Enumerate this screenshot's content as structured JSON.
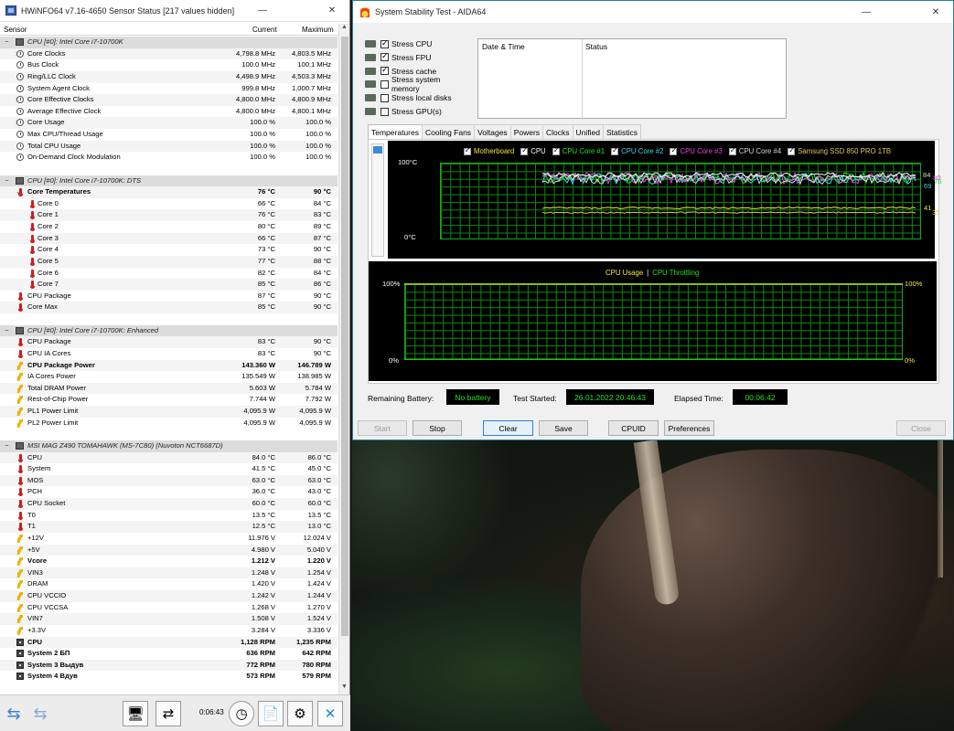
{
  "hwinfo": {
    "title": "HWiNFO64 v7.16-4650 Sensor Status [217 values hidden]",
    "columns": {
      "sensor": "Sensor",
      "current": "Current",
      "maximum": "Maximum"
    },
    "elapsed": "0:06:43",
    "rows": [
      {
        "type": "hdr",
        "label": "CPU [#0]: Intel Core i7-10700K",
        "expander": "−"
      },
      {
        "type": "data",
        "icon": "clock",
        "expander": "›",
        "label": "Core Clocks",
        "cur": "4,798.8 MHz",
        "max": "4,803.5 MHz",
        "alt": true
      },
      {
        "type": "data",
        "icon": "clock",
        "label": "Bus Clock",
        "cur": "100.0 MHz",
        "max": "100.1 MHz"
      },
      {
        "type": "data",
        "icon": "clock",
        "label": "Ring/LLC Clock",
        "cur": "4,498.9 MHz",
        "max": "4,503.3 MHz",
        "alt": true
      },
      {
        "type": "data",
        "icon": "clock",
        "label": "System Agent Clock",
        "cur": "999.8 MHz",
        "max": "1,000.7 MHz"
      },
      {
        "type": "data",
        "icon": "clock",
        "expander": "›",
        "label": "Core Effective Clocks",
        "cur": "4,800.0 MHz",
        "max": "4,800.9 MHz",
        "alt": true
      },
      {
        "type": "data",
        "icon": "clock",
        "label": "Average Effective Clock",
        "cur": "4,800.0 MHz",
        "max": "4,800.1 MHz"
      },
      {
        "type": "data",
        "icon": "clock",
        "expander": "›",
        "label": "Core Usage",
        "cur": "100.0 %",
        "max": "100.0 %",
        "alt": true
      },
      {
        "type": "data",
        "icon": "clock",
        "label": "Max CPU/Thread Usage",
        "cur": "100.0 %",
        "max": "100.0 %"
      },
      {
        "type": "data",
        "icon": "clock",
        "label": "Total CPU Usage",
        "cur": "100.0 %",
        "max": "100.0 %",
        "alt": true
      },
      {
        "type": "data",
        "icon": "clock",
        "label": "On-Demand Clock Modulation",
        "cur": "100.0 %",
        "max": "100.0 %"
      },
      {
        "type": "blank"
      },
      {
        "type": "hdr",
        "label": "CPU [#0]: Intel Core i7-10700K: DTS",
        "expander": "−"
      },
      {
        "type": "data",
        "icon": "therm",
        "expander": "⌄",
        "label": "Core Temperatures",
        "cur": "76 °C",
        "max": "90 °C",
        "bold": true,
        "alt": true
      },
      {
        "type": "sub",
        "icon": "therm",
        "label": "Core 0",
        "cur": "66 °C",
        "max": "84 °C"
      },
      {
        "type": "sub",
        "icon": "therm",
        "label": "Core 1",
        "cur": "76 °C",
        "max": "83 °C",
        "alt": true
      },
      {
        "type": "sub",
        "icon": "therm",
        "label": "Core 2",
        "cur": "80 °C",
        "max": "89 °C"
      },
      {
        "type": "sub",
        "icon": "therm",
        "label": "Core 3",
        "cur": "66 °C",
        "max": "87 °C",
        "alt": true
      },
      {
        "type": "sub",
        "icon": "therm",
        "label": "Core 4",
        "cur": "73 °C",
        "max": "90 °C"
      },
      {
        "type": "sub",
        "icon": "therm",
        "label": "Core 5",
        "cur": "77 °C",
        "max": "88 °C",
        "alt": true
      },
      {
        "type": "sub",
        "icon": "therm",
        "label": "Core 6",
        "cur": "82 °C",
        "max": "84 °C"
      },
      {
        "type": "sub",
        "icon": "therm",
        "label": "Core 7",
        "cur": "85 °C",
        "max": "86 °C",
        "alt": true
      },
      {
        "type": "data",
        "icon": "therm",
        "label": "CPU Package",
        "cur": "87 °C",
        "max": "90 °C"
      },
      {
        "type": "data",
        "icon": "therm",
        "label": "Core Max",
        "cur": "85 °C",
        "max": "90 °C",
        "alt": true
      },
      {
        "type": "blank"
      },
      {
        "type": "hdr",
        "label": "CPU [#0]: Intel Core i7-10700K: Enhanced",
        "expander": "−"
      },
      {
        "type": "data",
        "icon": "therm",
        "label": "CPU Package",
        "cur": "83 °C",
        "max": "90 °C",
        "alt": true
      },
      {
        "type": "data",
        "icon": "therm",
        "label": "CPU IA Cores",
        "cur": "83 °C",
        "max": "90 °C"
      },
      {
        "type": "data",
        "icon": "volt",
        "label": "CPU Package Power",
        "cur": "143.360 W",
        "max": "146.789 W",
        "bold": true,
        "alt": true
      },
      {
        "type": "data",
        "icon": "volt",
        "label": "IA Cores Power",
        "cur": "135.549 W",
        "max": "138.985 W"
      },
      {
        "type": "data",
        "icon": "volt",
        "label": "Total DRAM Power",
        "cur": "5.603 W",
        "max": "5.784 W",
        "alt": true
      },
      {
        "type": "data",
        "icon": "volt",
        "label": "Rest-of-Chip Power",
        "cur": "7.744 W",
        "max": "7.792 W"
      },
      {
        "type": "data",
        "icon": "volt",
        "label": "PL1 Power Limit",
        "cur": "4,095.9 W",
        "max": "4,095.9 W",
        "alt": true
      },
      {
        "type": "data",
        "icon": "volt",
        "label": "PL2 Power Limit",
        "cur": "4,095.9 W",
        "max": "4,095.9 W"
      },
      {
        "type": "blank"
      },
      {
        "type": "hdr",
        "label": "MSI MAG Z490 TOMAHAWK (MS-7C80) (Nuvoton NCT6687D)",
        "expander": "−"
      },
      {
        "type": "data",
        "icon": "therm",
        "label": "CPU",
        "cur": "84.0 °C",
        "max": "86.0 °C",
        "alt": true
      },
      {
        "type": "data",
        "icon": "therm",
        "label": "System",
        "cur": "41.5 °C",
        "max": "45.0 °C"
      },
      {
        "type": "data",
        "icon": "therm",
        "label": "MOS",
        "cur": "63.0 °C",
        "max": "63.0 °C",
        "alt": true
      },
      {
        "type": "data",
        "icon": "therm",
        "label": "PCH",
        "cur": "36.0 °C",
        "max": "43.0 °C"
      },
      {
        "type": "data",
        "icon": "therm",
        "label": "CPU Socket",
        "cur": "60.0 °C",
        "max": "60.0 °C",
        "alt": true
      },
      {
        "type": "data",
        "icon": "therm",
        "label": "T0",
        "cur": "13.5 °C",
        "max": "13.5 °C"
      },
      {
        "type": "data",
        "icon": "therm",
        "label": "T1",
        "cur": "12.5 °C",
        "max": "13.0 °C",
        "alt": true
      },
      {
        "type": "data",
        "icon": "volt",
        "label": "+12V",
        "cur": "11.976 V",
        "max": "12.024 V"
      },
      {
        "type": "data",
        "icon": "volt",
        "label": "+5V",
        "cur": "4.980 V",
        "max": "5.040 V",
        "alt": true
      },
      {
        "type": "data",
        "icon": "volt",
        "label": "Vcore",
        "cur": "1.212 V",
        "max": "1.220 V",
        "bold": true
      },
      {
        "type": "data",
        "icon": "volt",
        "label": "VIN3",
        "cur": "1.248 V",
        "max": "1.254 V",
        "alt": true
      },
      {
        "type": "data",
        "icon": "volt",
        "label": "DRAM",
        "cur": "1.420 V",
        "max": "1.424 V"
      },
      {
        "type": "data",
        "icon": "volt",
        "label": "CPU VCCIO",
        "cur": "1.242 V",
        "max": "1.244 V",
        "alt": true
      },
      {
        "type": "data",
        "icon": "volt",
        "label": "CPU VCCSA",
        "cur": "1.268 V",
        "max": "1.270 V"
      },
      {
        "type": "data",
        "icon": "volt",
        "label": "VIN7",
        "cur": "1.508 V",
        "max": "1.524 V",
        "alt": true
      },
      {
        "type": "data",
        "icon": "volt",
        "label": "+3.3V",
        "cur": "3.284 V",
        "max": "3.336 V"
      },
      {
        "type": "data",
        "icon": "fan",
        "label": "CPU",
        "cur": "1,128 RPM",
        "max": "1,235 RPM",
        "bold": true,
        "alt": true
      },
      {
        "type": "data",
        "icon": "fan",
        "label": "System 2 БП",
        "cur": "636 RPM",
        "max": "642 RPM",
        "bold": true
      },
      {
        "type": "data",
        "icon": "fan",
        "label": "System 3 Выдув",
        "cur": "772 RPM",
        "max": "780 RPM",
        "bold": true,
        "alt": true
      },
      {
        "type": "data",
        "icon": "fan",
        "label": "System 4 Вдув",
        "cur": "573 RPM",
        "max": "579 RPM",
        "bold": true
      }
    ]
  },
  "aida": {
    "title": "System Stability Test - AIDA64",
    "stress": [
      {
        "label": "Stress CPU",
        "checked": true
      },
      {
        "label": "Stress FPU",
        "checked": true
      },
      {
        "label": "Stress cache",
        "checked": true
      },
      {
        "label": "Stress system memory",
        "checked": false
      },
      {
        "label": "Stress local disks",
        "checked": false
      },
      {
        "label": "Stress GPU(s)",
        "checked": false
      }
    ],
    "status_headers": {
      "date": "Date & Time",
      "status": "Status"
    },
    "tabs": [
      "Temperatures",
      "Cooling Fans",
      "Voltages",
      "Powers",
      "Clocks",
      "Unified",
      "Statistics"
    ],
    "active_tab": "Temperatures",
    "temp_graph": {
      "y_top": "100°C",
      "y_bottom": "0°C",
      "legend": [
        {
          "label": "Motherboard",
          "color": "#f2e646"
        },
        {
          "label": "CPU",
          "color": "#ffffff"
        },
        {
          "label": "CPU Core #1",
          "color": "#22e022"
        },
        {
          "label": "CPU Core #2",
          "color": "#3ad6e8"
        },
        {
          "label": "CPU Core #3",
          "color": "#e044e0"
        },
        {
          "label": "CPU Core #4",
          "color": "#d8d8d8"
        },
        {
          "label": "Samsung SSD 850 PRO 1TB",
          "color": "#e0c85a"
        }
      ],
      "right_values": [
        "84",
        "80",
        "76",
        "69",
        "41",
        "35"
      ]
    },
    "usage_graph": {
      "legend_usage": "CPU Usage",
      "legend_sep": "|",
      "legend_throttle": "CPU Throttling",
      "y_top_left": "100%",
      "y_bottom_left": "0%",
      "y_top_right": "100%",
      "y_bottom_right": "0%"
    },
    "info": {
      "battery_label": "Remaining Battery:",
      "battery_value": "No battery",
      "started_label": "Test Started:",
      "started_value": "26.01.2022 20:46:43",
      "elapsed_label": "Elapsed Time:",
      "elapsed_value": "00:06:42"
    },
    "buttons": {
      "start": "Start",
      "stop": "Stop",
      "clear": "Clear",
      "save": "Save",
      "cpuid": "CPUID",
      "preferences": "Preferences",
      "close": "Close"
    }
  },
  "colors": {
    "grid": "#0b8a0b",
    "lcd_text": "#22e022",
    "accent_border": "#2a7f9a"
  }
}
